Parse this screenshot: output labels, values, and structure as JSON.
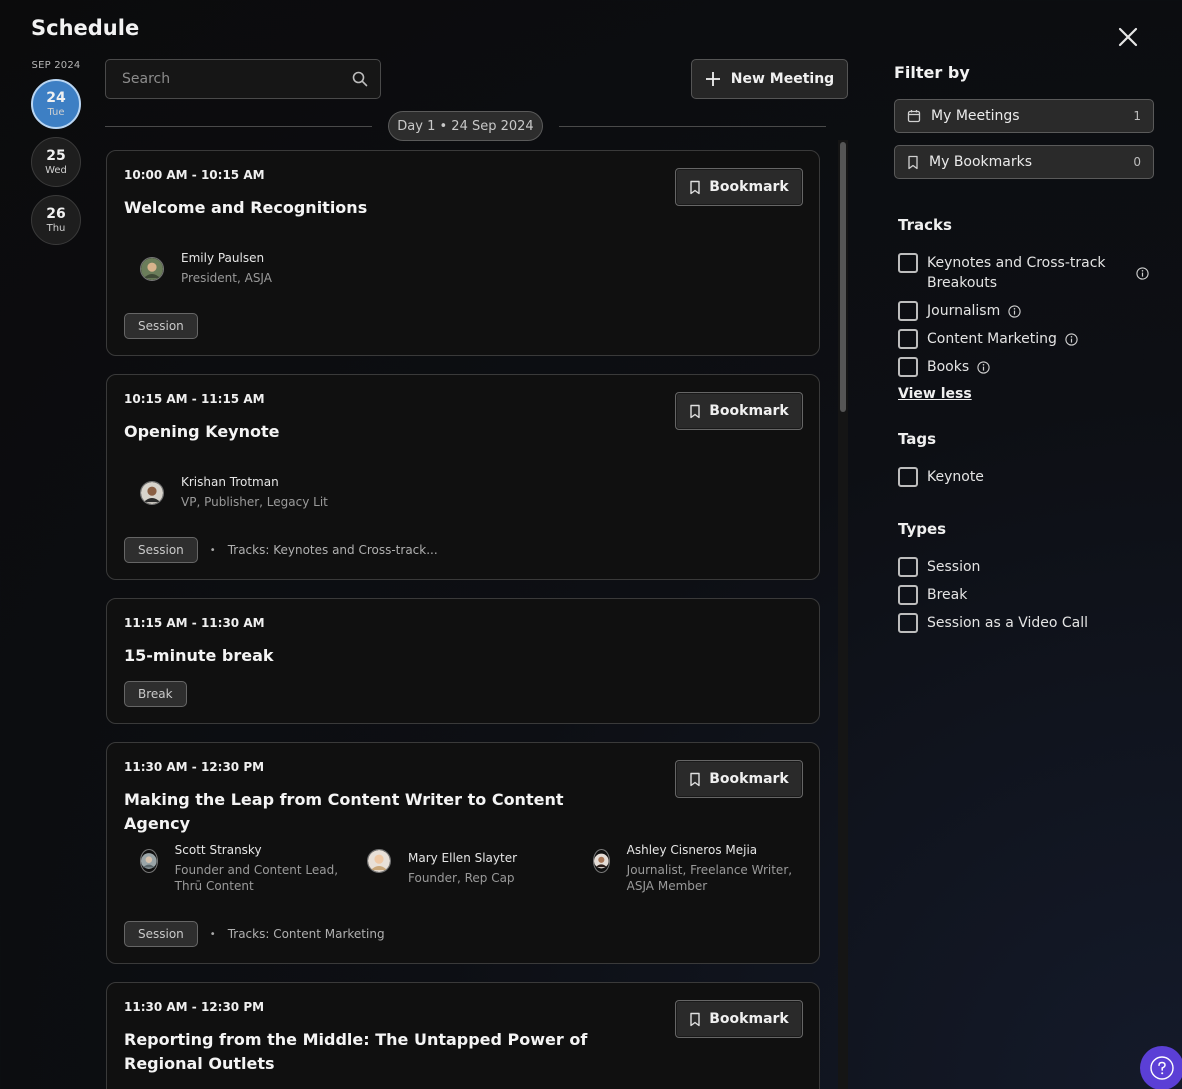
{
  "page": {
    "title": "Schedule"
  },
  "dates": {
    "month": "SEP 2024",
    "days": [
      {
        "num": "24",
        "weekday": "Tue",
        "active": true
      },
      {
        "num": "25",
        "weekday": "Wed",
        "active": false
      },
      {
        "num": "26",
        "weekday": "Thu",
        "active": false
      }
    ]
  },
  "search": {
    "placeholder": "Search",
    "value": ""
  },
  "toolbar": {
    "new_meeting_label": "New Meeting"
  },
  "day_divider": "Day 1 • 24 Sep 2024",
  "sessions": [
    {
      "time": "10:00 AM - 10:15 AM",
      "title": "Welcome and Recognitions",
      "bookmark_label": "Bookmark",
      "speakers": [
        {
          "name": "Emily Paulsen",
          "role": "President, ASJA"
        }
      ],
      "type": "Session",
      "tracks": ""
    },
    {
      "time": "10:15 AM - 11:15 AM",
      "title": "Opening Keynote",
      "bookmark_label": "Bookmark",
      "speakers": [
        {
          "name": "Krishan Trotman",
          "role": "VP, Publisher, Legacy Lit"
        }
      ],
      "type": "Session",
      "tracks": "Tracks: Keynotes and Cross-track..."
    },
    {
      "time": "11:15 AM - 11:30 AM",
      "title": "15-minute break",
      "type": "Break"
    },
    {
      "time": "11:30 AM - 12:30 PM",
      "title": "Making the Leap from Content Writer to Content Agency",
      "bookmark_label": "Bookmark",
      "speakers": [
        {
          "name": "Scott Stransky",
          "role": "Founder and Content Lead, Thrū Content"
        },
        {
          "name": "Mary Ellen Slayter",
          "role": "Founder, Rep Cap"
        },
        {
          "name": "Ashley Cisneros Mejia",
          "role": "Journalist, Freelance Writer, ASJA Member"
        }
      ],
      "type": "Session",
      "tracks": "Tracks: Content Marketing"
    },
    {
      "time": "11:30 AM - 12:30 PM",
      "title": "Reporting from the Middle: The Untapped Power of Regional Outlets",
      "bookmark_label": "Bookmark"
    }
  ],
  "filters": {
    "title": "Filter by",
    "my_meetings": {
      "label": "My Meetings",
      "count": "1"
    },
    "my_bookmarks": {
      "label": "My Bookmarks",
      "count": "0"
    },
    "tracks_heading": "Tracks",
    "tracks": [
      "Keynotes and Cross-track Breakouts",
      "Journalism",
      "Content Marketing",
      "Books"
    ],
    "view_less": "View less",
    "tags_heading": "Tags",
    "tags": [
      "Keynote"
    ],
    "types_heading": "Types",
    "types": [
      "Session",
      "Break",
      "Session as a Video Call"
    ]
  },
  "colors": {
    "accent_day": "#3d7fc4",
    "help_button": "#5b3fd6"
  },
  "icons": {
    "close": "close-icon",
    "search": "search-icon",
    "plus": "plus-icon",
    "bookmark": "bookmark-icon",
    "calendar": "calendar-icon",
    "info": "info-icon",
    "help": "help-icon"
  }
}
